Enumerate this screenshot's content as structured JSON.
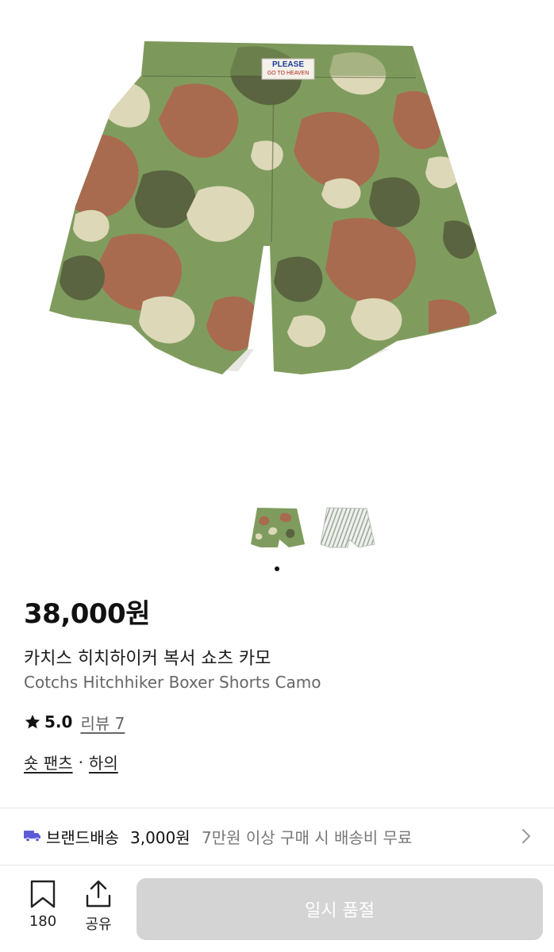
{
  "product": {
    "price": "38,000원",
    "name_ko": "카치스 히치하이커 복서 쇼츠 카모",
    "name_en": "Cotchs Hitchhiker Boxer Shorts Camo",
    "label_line1": "PLEASE",
    "label_line2": "GO TO HEAVEN"
  },
  "gallery": {
    "thumbnails": [
      "camo-shorts",
      "striped-shorts"
    ],
    "active_index": 0
  },
  "rating": {
    "star_icon": "star-icon",
    "value": "5.0",
    "review_label": "리뷰 7"
  },
  "category": {
    "primary": "숏 팬츠",
    "separator": "·",
    "secondary": "하의"
  },
  "shipping": {
    "icon": "truck-icon",
    "label": "브랜드배송",
    "fee": "3,000원",
    "condition": "7만원 이상 구매 시 배송비 무료"
  },
  "bottom_bar": {
    "bookmark_count": "180",
    "share_label": "공유",
    "action_label": "일시 품절"
  },
  "colors": {
    "accent_truck": "#5b5bd6",
    "soldout_bg": "#d4d4d4",
    "camo_green": "#7f9c5e",
    "camo_brown": "#a86b4f",
    "camo_cream": "#ddd8b8",
    "camo_dark": "#5a6440"
  }
}
